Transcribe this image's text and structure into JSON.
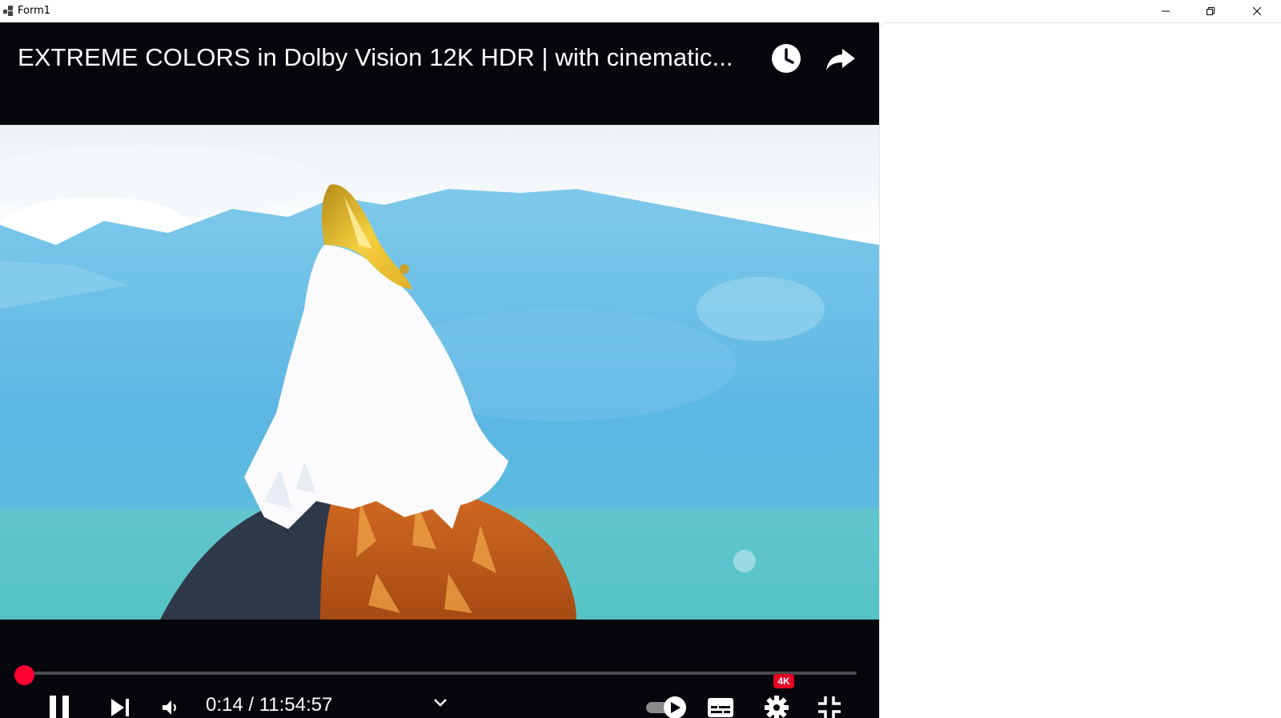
{
  "window": {
    "title": "Form1",
    "buttons": {
      "minimize": "minimize-icon",
      "restore": "restore-icon",
      "close": "close-icon"
    }
  },
  "player": {
    "title": "EXTREME COLORS in Dolby Vision 12K HDR | with cinematic...",
    "top_icons": [
      "watch-later-icon",
      "share-icon"
    ],
    "time": {
      "current": "0:14",
      "duration": "11:54:57",
      "display": "0:14 / 11:54:57"
    },
    "progress_fraction": 0.0003,
    "quality_badge": "4K",
    "controls": [
      "pause-icon",
      "next-icon",
      "volume-icon",
      "chevron-down-icon",
      "autoplay-toggle",
      "subtitles-icon",
      "settings-icon",
      "exit-fullscreen-icon"
    ],
    "colors": {
      "accent": "#ff0033",
      "background": "#05070d",
      "text": "#ffffff"
    }
  }
}
